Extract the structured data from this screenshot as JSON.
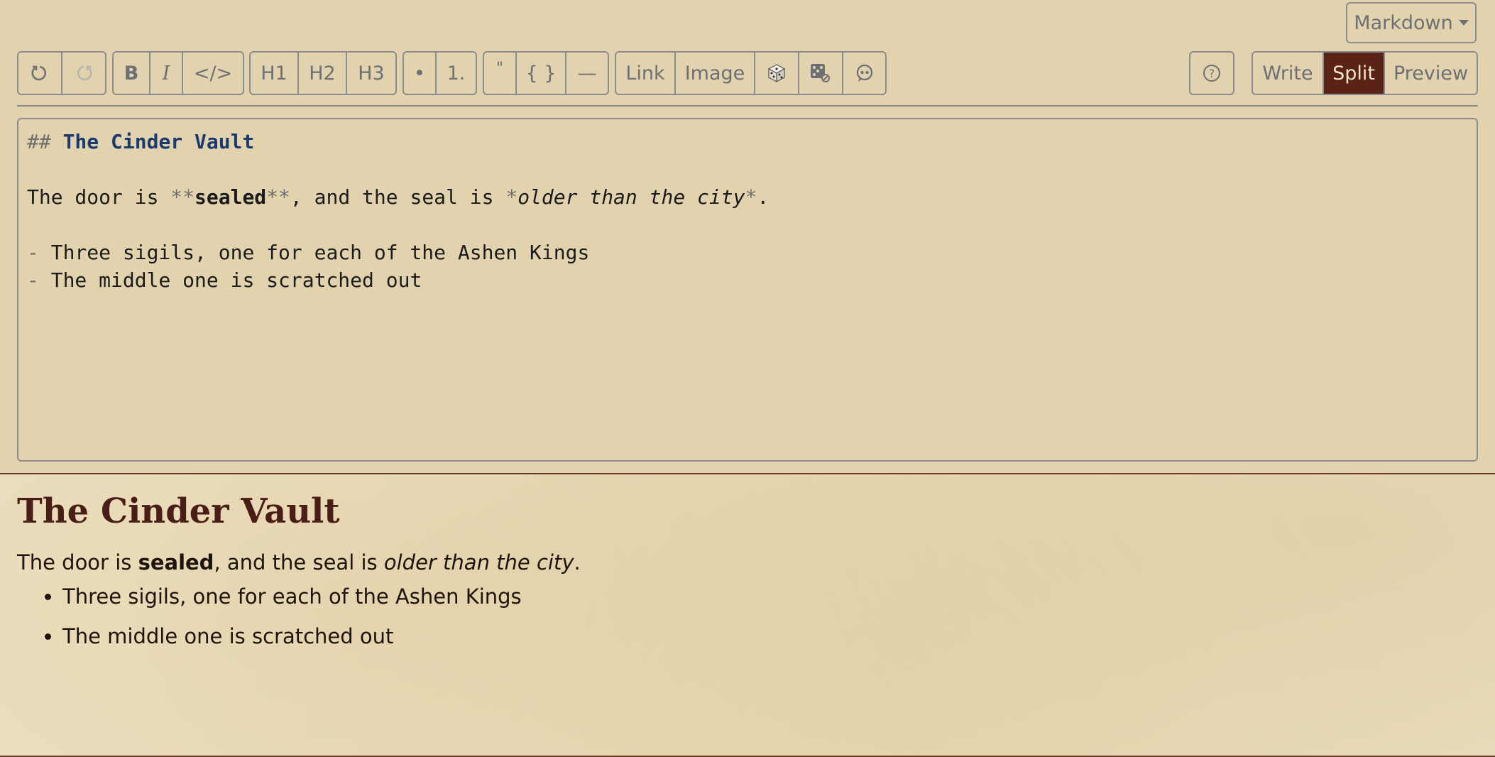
{
  "mode_selector": {
    "label": "Markdown"
  },
  "toolbar": {
    "undo_icon": "undo-icon",
    "redo_icon": "redo-icon",
    "bold": "B",
    "italic": "I",
    "code": "</>",
    "h1": "H1",
    "h2": "H2",
    "h3": "H3",
    "bullet_list": "•",
    "numbered_list": "1.",
    "quote": "\"",
    "code_block": "{ }",
    "horizontal_rule": "—",
    "link": "Link",
    "image": "Image",
    "dice_icon": "dice-icon",
    "table_link_icon": "table-link-icon",
    "comment_icon": "comment-icon",
    "help_icon": "help-icon"
  },
  "view_tabs": {
    "write": "Write",
    "split": "Split",
    "preview": "Preview",
    "active": "Split"
  },
  "editor": {
    "heading_marker": "## ",
    "heading_text": "The Cinder Vault",
    "para_pre": "The door is ",
    "bold_mark": "**",
    "bold_text": "sealed",
    "para_mid": ", and the seal is ",
    "italic_mark": "*",
    "italic_text": "older than the city",
    "para_end": ".",
    "list_marker": "- ",
    "list_items": [
      "Three sigils, one for each of the Ashen Kings",
      "The middle one is scratched out"
    ]
  },
  "preview": {
    "heading": "The Cinder Vault",
    "para_pre": "The door is ",
    "bold_text": "sealed",
    "para_mid": ", and the seal is ",
    "italic_text": "older than the city",
    "para_end": ".",
    "list_items": [
      "Three sigils, one for each of the Ashen Kings",
      "The middle one is scratched out"
    ]
  },
  "colors": {
    "accent": "#5b2218",
    "heading": "#4a1d16",
    "md_heading": "#1b3b6f",
    "border": "#8c8c8c"
  }
}
